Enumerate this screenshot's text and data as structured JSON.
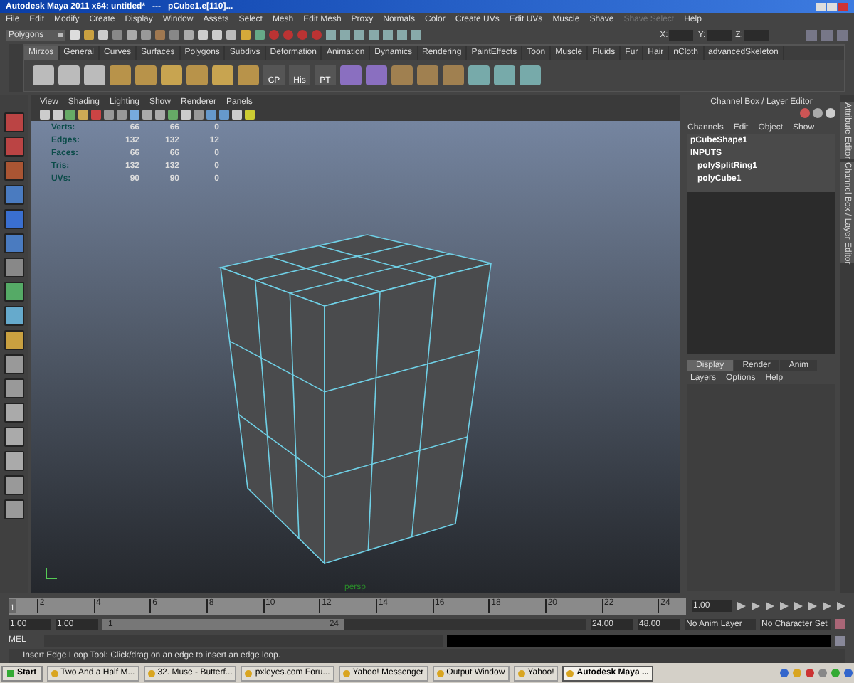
{
  "window": {
    "title": "Autodesk Maya 2011 x64: untitled*   ---   pCube1.e[110]..."
  },
  "menubar": {
    "items": [
      {
        "label": "File",
        "disabled": false
      },
      {
        "label": "Edit",
        "disabled": false
      },
      {
        "label": "Modify",
        "disabled": false
      },
      {
        "label": "Create",
        "disabled": false
      },
      {
        "label": "Display",
        "disabled": false
      },
      {
        "label": "Window",
        "disabled": false
      },
      {
        "label": "Assets",
        "disabled": false
      },
      {
        "label": "Select",
        "disabled": false
      },
      {
        "label": "Mesh",
        "disabled": false
      },
      {
        "label": "Edit Mesh",
        "disabled": false
      },
      {
        "label": "Proxy",
        "disabled": false
      },
      {
        "label": "Normals",
        "disabled": false
      },
      {
        "label": "Color",
        "disabled": false
      },
      {
        "label": "Create UVs",
        "disabled": false
      },
      {
        "label": "Edit UVs",
        "disabled": false
      },
      {
        "label": "Muscle",
        "disabled": false
      },
      {
        "label": "Shave",
        "disabled": false
      },
      {
        "label": "Shave Select",
        "disabled": true
      },
      {
        "label": "Help",
        "disabled": false
      }
    ]
  },
  "status_line": {
    "mode": "Polygons",
    "coord_labels": [
      "X:",
      "Y:",
      "Z:"
    ]
  },
  "shelf": {
    "tabs": [
      {
        "label": "Mirzos",
        "selected": true
      },
      {
        "label": "General",
        "selected": false
      },
      {
        "label": "Curves",
        "selected": false
      },
      {
        "label": "Surfaces",
        "selected": false
      },
      {
        "label": "Polygons",
        "selected": false
      },
      {
        "label": "Subdivs",
        "selected": false
      },
      {
        "label": "Deformation",
        "selected": false
      },
      {
        "label": "Animation",
        "selected": false
      },
      {
        "label": "Dynamics",
        "selected": false
      },
      {
        "label": "Rendering",
        "selected": false
      },
      {
        "label": "PaintEffects",
        "selected": false
      },
      {
        "label": "Toon",
        "selected": false
      },
      {
        "label": "Muscle",
        "selected": false
      },
      {
        "label": "Fluids",
        "selected": false
      },
      {
        "label": "Fur",
        "selected": false
      },
      {
        "label": "Hair",
        "selected": false
      },
      {
        "label": "nCloth",
        "selected": false
      },
      {
        "label": "advancedSkeleton",
        "selected": false
      }
    ],
    "labeled_buttons": [
      "CP",
      "His",
      "PT"
    ]
  },
  "viewport": {
    "menu": [
      "View",
      "Shading",
      "Lighting",
      "Show",
      "Renderer",
      "Panels"
    ],
    "hud": [
      {
        "label": "Verts:",
        "values": [
          "66",
          "66",
          "0"
        ]
      },
      {
        "label": "Edges:",
        "values": [
          "132",
          "132",
          "12"
        ]
      },
      {
        "label": "Faces:",
        "values": [
          "66",
          "66",
          "0"
        ]
      },
      {
        "label": "Tris:",
        "values": [
          "132",
          "132",
          "0"
        ]
      },
      {
        "label": "UVs:",
        "values": [
          "90",
          "90",
          "0"
        ]
      }
    ],
    "camera_label": "persp"
  },
  "channel_box": {
    "title": "Channel Box / Layer Editor",
    "menu": [
      "Channels",
      "Edit",
      "Object",
      "Show"
    ],
    "nodes": [
      {
        "label": "pCubeShape1"
      },
      {
        "label": "INPUTS",
        "children": [
          {
            "label": "polySplitRing1"
          },
          {
            "label": "polyCube1"
          }
        ]
      }
    ],
    "layer_tabs": [
      {
        "label": "Display",
        "selected": true
      },
      {
        "label": "Render",
        "selected": false
      },
      {
        "label": "Anim",
        "selected": false
      }
    ],
    "layer_menu": [
      "Layers",
      "Options",
      "Help"
    ]
  },
  "side_tabs": [
    "Attribute Editor",
    "Channel Box / Layer Editor"
  ],
  "time_slider": {
    "current_frame": "1",
    "level": 0,
    "tick_labels": [
      "2",
      "4",
      "6",
      "8",
      "10",
      "12",
      "14",
      "16",
      "18",
      "20",
      "22",
      "24"
    ],
    "current_time": "1.00"
  },
  "range_slider": {
    "level": 0.5,
    "start": "1.00",
    "playback_start": "1.00",
    "range_start": "1",
    "range_end": "24",
    "playback_end": "24.00",
    "end": "48.00",
    "anim_layer": "No Anim Layer",
    "character_set": "No Character Set"
  },
  "command_line": {
    "label": "MEL"
  },
  "help_line": "Insert Edge Loop Tool: Click/drag on an edge to insert an edge loop.",
  "taskbar": {
    "start": "Start",
    "items": [
      {
        "label": "Two And a Half M...",
        "selected": false
      },
      {
        "label": "32. Muse - Butterf...",
        "selected": false
      },
      {
        "label": "pxleyes.com Foru...",
        "selected": false
      },
      {
        "label": "Yahoo! Messenger",
        "selected": false
      },
      {
        "label": "Output Window",
        "selected": false
      },
      {
        "label": "Yahoo!",
        "selected": false
      },
      {
        "label": "Autodesk Maya ...",
        "selected": true
      }
    ]
  }
}
